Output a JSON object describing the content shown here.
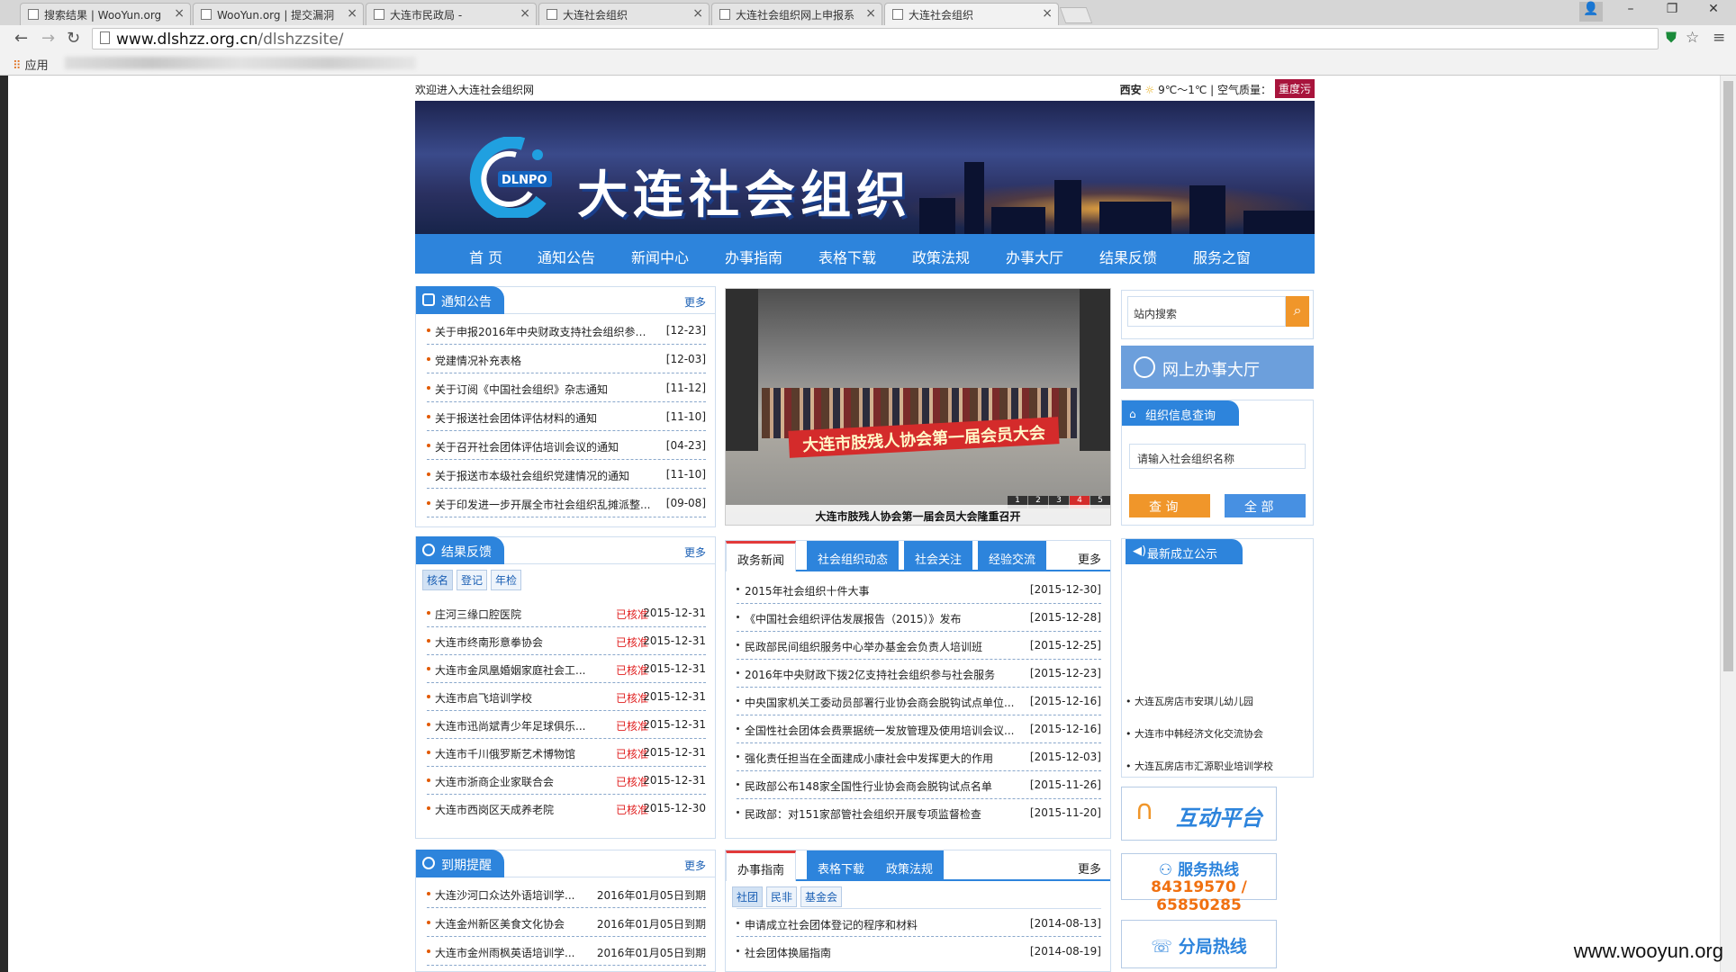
{
  "browser": {
    "tabs": [
      {
        "title": "搜索结果 | WooYun.org"
      },
      {
        "title": "WooYun.org | 提交漏洞"
      },
      {
        "title": "大连市民政局 -"
      },
      {
        "title": "大连社会组织"
      },
      {
        "title": "大连社会组织网上申报系"
      },
      {
        "title": "大连社会组织"
      }
    ],
    "url_host": "www.dlshzz.org.cn",
    "url_path": "/dlshzzsite/",
    "bookmarks_apps": "应用"
  },
  "site": {
    "welcome": "欢迎进入大连社会组织网",
    "weather_city": "西安",
    "weather_temp": "9℃～1℃",
    "air_label": "空气质量：",
    "air_value": "重度污",
    "banner_title": "大连社会组织",
    "banner_logo_text": "DLNPO",
    "nav": [
      "首 页",
      "通知公告",
      "新闻中心",
      "办事指南",
      "表格下载",
      "政策法规",
      "办事大厅",
      "结果反馈",
      "服务之窗"
    ],
    "more": "更多"
  },
  "notices": {
    "title": "通知公告",
    "items": [
      {
        "t": "关于申报2016年中央财政支持社会组织参与...",
        "d": "[12-23]"
      },
      {
        "t": "党建情况补充表格",
        "d": "[12-03]"
      },
      {
        "t": "关于订阅《中国社会组织》杂志通知",
        "d": "[11-12]"
      },
      {
        "t": "关于报送社会团体评估材料的通知",
        "d": "[11-10]"
      },
      {
        "t": "关于召开社会团体评估培训会议的通知",
        "d": "[04-23]"
      },
      {
        "t": "关于报送市本级社会组织党建情况的通知",
        "d": "[11-10]"
      },
      {
        "t": "关于印发进一步开展全市社会组织乱摊派整...",
        "d": "[09-08]"
      }
    ]
  },
  "slider": {
    "banner_text": "大连市肢残人协会第一届会员大会",
    "caption": "大连市肢残人协会第一届会员大会隆重召开",
    "pages": [
      "1",
      "2",
      "3",
      "4",
      "5"
    ]
  },
  "search": {
    "placeholder": "站内搜索",
    "go_icon": "search-icon"
  },
  "hall": {
    "label": "网上办事大厅"
  },
  "orgquery": {
    "title": "组织信息查询",
    "placeholder": "请输入社会组织名称",
    "query": "查 询",
    "all": "全 部"
  },
  "results": {
    "title": "结果反馈",
    "subtabs": [
      "核名",
      "登记",
      "年检"
    ],
    "items": [
      {
        "t": "庄河三缘口腔医院",
        "s": "已核准",
        "d": "2015-12-31"
      },
      {
        "t": "大连市终南形意拳协会",
        "s": "已核准",
        "d": "2015-12-31"
      },
      {
        "t": "大连市金凤凰婚姻家庭社会工...",
        "s": "已核准",
        "d": "2015-12-31"
      },
      {
        "t": "大连市启飞培训学校",
        "s": "已核准",
        "d": "2015-12-31"
      },
      {
        "t": "大连市迅尚斌青少年足球俱乐...",
        "s": "已核准",
        "d": "2015-12-31"
      },
      {
        "t": "大连市千川俄罗斯艺术博物馆",
        "s": "已核准",
        "d": "2015-12-31"
      },
      {
        "t": "大连市浙商企业家联合会",
        "s": "已核准",
        "d": "2015-12-31"
      },
      {
        "t": "大连市西岗区天成养老院",
        "s": "已核准",
        "d": "2015-12-30"
      }
    ]
  },
  "news": {
    "tabs": [
      "政务新闻",
      "社会组织动态",
      "社会关注",
      "经验交流"
    ],
    "items": [
      {
        "t": "2015年社会组织十件大事",
        "d": "[2015-12-30]"
      },
      {
        "t": "《中国社会组织评估发展报告（2015）》发布",
        "d": "[2015-12-28]"
      },
      {
        "t": "民政部民间组织服务中心举办基金会负责人培训班",
        "d": "[2015-12-25]"
      },
      {
        "t": "2016年中央财政下拨2亿支持社会组织参与社会服务",
        "d": "[2015-12-23]"
      },
      {
        "t": "中央国家机关工委动员部署行业协会商会脱钩试点单位...",
        "d": "[2015-12-16]"
      },
      {
        "t": "全国性社会团体会费票据统一发放管理及使用培训会议...",
        "d": "[2015-12-16]"
      },
      {
        "t": "强化责任担当在全面建成小康社会中发挥更大的作用",
        "d": "[2015-12-03]"
      },
      {
        "t": "民政部公布148家全国性行业协会商会脱钩试点名单",
        "d": "[2015-11-26]"
      },
      {
        "t": "民政部：对151家部管社会组织开展专项监督检查",
        "d": "[2015-11-20]"
      }
    ]
  },
  "newest": {
    "title": "最新成立公示",
    "items": [
      "大连瓦房店市安琪儿幼儿园",
      "大连市中韩经济文化交流协会",
      "大连瓦房店市汇源职业培训学校"
    ]
  },
  "interactive": {
    "label": "互动平台"
  },
  "hotline": {
    "label": "服务热线",
    "numbers": "84319570 / 65850285"
  },
  "branch": {
    "label": "分局热线"
  },
  "expiry": {
    "title": "到期提醒",
    "items": [
      {
        "t": "大连沙河口众达外语培训学...",
        "d": "2016年01月05日到期"
      },
      {
        "t": "大连金州新区美食文化协会",
        "d": "2016年01月05日到期"
      },
      {
        "t": "大连市金州雨枫英语培训学...",
        "d": "2016年01月05日到期"
      }
    ]
  },
  "guide": {
    "tabs": [
      "办事指南",
      "表格下载",
      "政策法规"
    ],
    "subtabs": [
      "社团",
      "民非",
      "基金会"
    ],
    "items": [
      {
        "t": "申请成立社会团体登记的程序和材料",
        "d": "[2014-08-13]"
      },
      {
        "t": "社会团体换届指南",
        "d": "[2014-08-19]"
      }
    ]
  },
  "watermark": "www.wooyun.org"
}
